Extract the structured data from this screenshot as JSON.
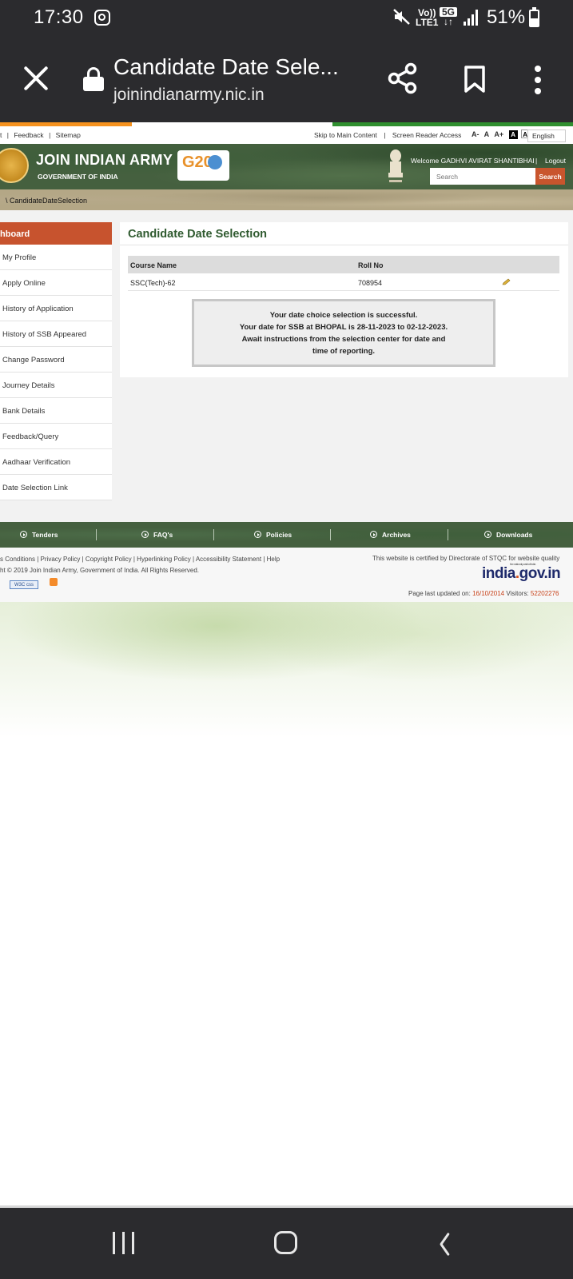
{
  "status_bar": {
    "time": "17:30",
    "volte_line1": "Vo))",
    "volte_line2": "LTE1",
    "network": "5G",
    "network_arrows": "↓↑",
    "battery": "51%"
  },
  "browser": {
    "title": "Candidate Date Sele...",
    "url": "joinindianarmy.nic.in"
  },
  "utility_bar": {
    "left_links": [
      "t",
      "|",
      "Feedback",
      "|",
      "Sitemap"
    ],
    "skip_main": "Skip to Main Content",
    "divider": "|",
    "screen_reader": "Screen Reader Access",
    "font_small": "A-",
    "font_normal": "A",
    "font_large": "A+",
    "contrast_dark": "A",
    "contrast_light": "A",
    "language": "English"
  },
  "header": {
    "site_name": "JOIN INDIAN ARMY",
    "site_sub": "GOVERNMENT OF INDIA",
    "g20": "G20",
    "welcome": "Welcome GADHVI AVIRAT SHANTIBHAI",
    "separator": "|",
    "logout": "Logout",
    "search_placeholder": "Search",
    "search_button": "Search"
  },
  "breadcrumb": "\\  CandidateDateSelection",
  "sidebar": {
    "heading": "hboard",
    "items": [
      "My Profile",
      "Apply Online",
      "History of Application",
      "History of SSB Appeared",
      "Change Password",
      "Journey Details",
      "Bank Details",
      "Feedback/Query",
      "Aadhaar Verification",
      "Date Selection Link"
    ]
  },
  "main": {
    "title": "Candidate Date Selection",
    "table": {
      "headers": [
        "Course Name",
        "Roll No"
      ],
      "rows": [
        {
          "course": "SSC(Tech)-62",
          "roll": "708954"
        }
      ]
    },
    "message": {
      "line1": "Your date choice selection is successful.",
      "line2": "Your date for SSB at BHOPAL is 28-11-2023 to 02-12-2023.",
      "line3": "Await instructions from the selection center for date and",
      "line4": "time of reporting."
    }
  },
  "footer_nav": [
    "Tenders",
    "FAQ's",
    "Policies",
    "Archives",
    "Downloads"
  ],
  "footer": {
    "links": "s Conditions  |  Privacy Policy  |  Copyright Policy  |  Hyperlinking Policy  |  Accessibility Statement  |  Help",
    "copyright": "ht © 2019 Join Indian Army, Government of India. All Rights Reserved.",
    "w3c": "W3C css",
    "certified": "This website is certified by Directorate of STQC for website quality",
    "india_portal_tag": "the national portal of india",
    "india_portal_main": "india",
    "india_portal_dot": ".",
    "india_portal_tld": "gov.in",
    "updated_label": "Page last updated on:",
    "updated_date": "16/10/2014",
    "visitors_label": "Visitors:",
    "visitors": "52202276"
  },
  "colors": {
    "accent_orange": "#c7532e",
    "army_green": "#45603f",
    "title_green": "#2f5a2f",
    "chrome_dark": "#2b2b2e"
  },
  "icons": [
    "instagram-icon",
    "mute-icon",
    "signal-icon",
    "battery-icon",
    "close-icon",
    "lock-icon",
    "share-icon",
    "bookmark-icon",
    "more-icon",
    "edit-icon",
    "rss-icon",
    "recents-icon",
    "home-icon",
    "back-icon"
  ]
}
